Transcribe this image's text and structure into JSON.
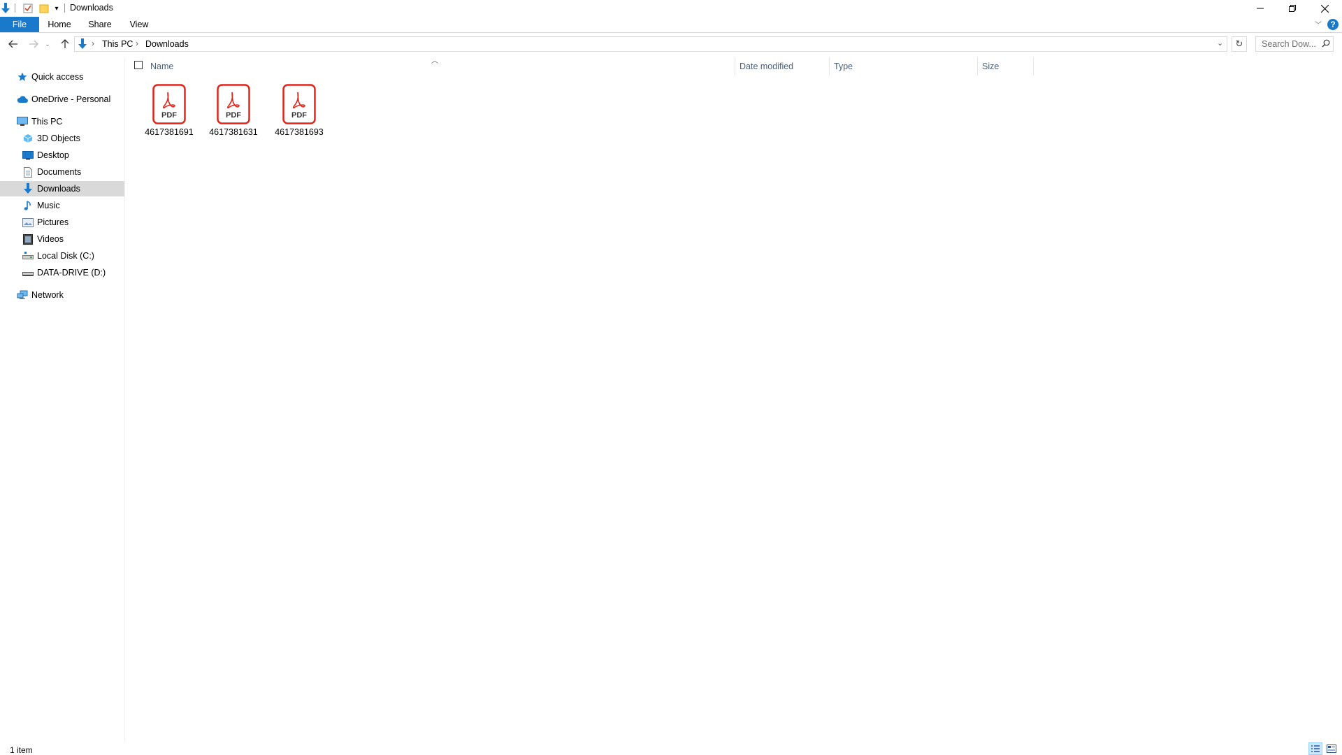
{
  "window": {
    "title": "Downloads",
    "controls": [
      "minimize",
      "restore",
      "close"
    ]
  },
  "ribbon": {
    "tabs": [
      "File",
      "Home",
      "Share",
      "View"
    ]
  },
  "address": {
    "crumbs": [
      "This PC",
      "Downloads"
    ],
    "search_placeholder": "Search Dow..."
  },
  "nav": {
    "items": [
      {
        "label": "Quick access",
        "icon": "star-icon"
      },
      {
        "label": "OneDrive - Personal",
        "icon": "cloud-icon"
      },
      {
        "label": "This PC",
        "icon": "computer-icon"
      },
      {
        "label": "3D Objects",
        "icon": "cube-icon"
      },
      {
        "label": "Desktop",
        "icon": "desktop-icon"
      },
      {
        "label": "Documents",
        "icon": "document-icon"
      },
      {
        "label": "Downloads",
        "icon": "download-icon",
        "selected": true
      },
      {
        "label": "Music",
        "icon": "music-icon"
      },
      {
        "label": "Pictures",
        "icon": "picture-icon"
      },
      {
        "label": "Videos",
        "icon": "video-icon"
      },
      {
        "label": "Local Disk (C:)",
        "icon": "drive-icon"
      },
      {
        "label": "DATA-DRIVE (D:)",
        "icon": "drive-icon"
      },
      {
        "label": "Network",
        "icon": "network-icon"
      }
    ]
  },
  "columns": [
    "Name",
    "Date modified",
    "Type",
    "Size"
  ],
  "files": [
    {
      "name": "4617381691",
      "badge": "PDF"
    },
    {
      "name": "4617381631",
      "badge": "PDF"
    },
    {
      "name": "4617381693",
      "badge": "PDF"
    }
  ],
  "status": {
    "text": "1 item"
  },
  "colors": {
    "accent": "#1979ca",
    "selected": "#d9d9d9",
    "pdf_red": "#e1251b"
  }
}
